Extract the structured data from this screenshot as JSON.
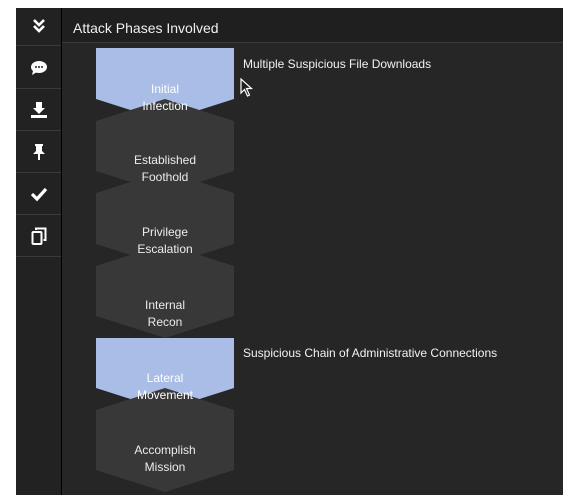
{
  "sidebar": {
    "buttons": [
      {
        "icon": "double-chevron-down-icon"
      },
      {
        "icon": "comment-icon"
      },
      {
        "icon": "download-icon"
      },
      {
        "icon": "pin-icon"
      },
      {
        "icon": "checkmark-icon"
      },
      {
        "icon": "copy-icon"
      }
    ]
  },
  "header": {
    "title": "Attack Phases Involved"
  },
  "phases": [
    {
      "line1": "Initial",
      "line2": "Infection",
      "active": true
    },
    {
      "line1": "Established",
      "line2": "Foothold",
      "active": false
    },
    {
      "line1": "Privilege",
      "line2": "Escalation",
      "active": false
    },
    {
      "line1": "Internal",
      "line2": "Recon",
      "active": false
    },
    {
      "line1": "Lateral",
      "line2": "Movement",
      "active": true
    },
    {
      "line1": "Accomplish",
      "line2": "Mission",
      "active": false
    }
  ],
  "notes": {
    "initial": "Multiple Suspicious File Downloads",
    "lateral": "Suspicious Chain of Administrative Connections"
  },
  "colors": {
    "active": "#a9bde6",
    "inactive": "#383838",
    "background": "#262626"
  }
}
